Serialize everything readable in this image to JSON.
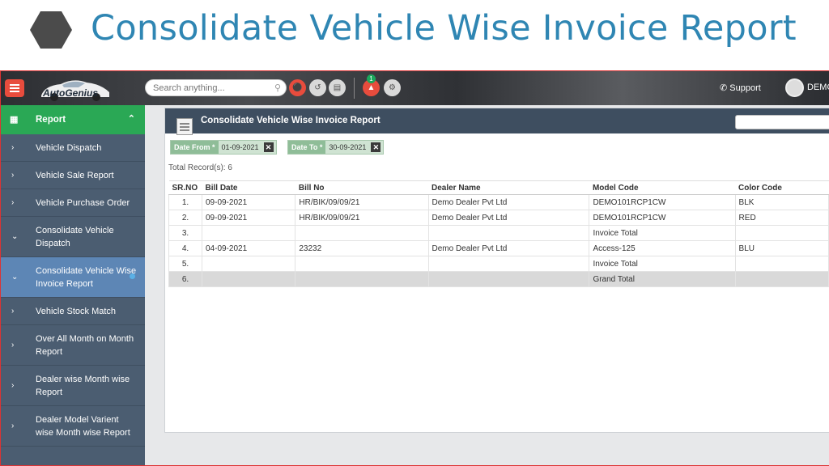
{
  "slide": {
    "title": "Consolidate Vehicle Wise Invoice Report"
  },
  "topbar": {
    "logo_text": "AutoGenius",
    "search_placeholder": "Search anything...",
    "notification_count": "1",
    "support_label": "Support",
    "user_name": "DEMO",
    "icon_colors": {
      "menu": "#e84c3d",
      "car": "#e84c3d",
      "share": "#d9d9d9",
      "chart": "#d9d9d9"
    }
  },
  "sidebar": {
    "header": {
      "label": "Report",
      "icon": "report-icon"
    },
    "items": [
      {
        "label": "Vehicle Dispatch",
        "arrow": "›"
      },
      {
        "label": "Vehicle Sale Report",
        "arrow": "›"
      },
      {
        "label": "Vehicle Purchase Order",
        "arrow": "›"
      },
      {
        "label": "Consolidate Vehicle Dispatch",
        "arrow": "⌄"
      },
      {
        "label": "Consolidate Vehicle Wise Invoice Report",
        "arrow": "⌄",
        "active": true
      },
      {
        "label": "Vehicle Stock Match",
        "arrow": "›"
      },
      {
        "label": "Over All Month on Month Report",
        "arrow": "›"
      },
      {
        "label": "Dealer wise Month wise Report",
        "arrow": "›"
      },
      {
        "label": "Dealer Model Varient wise Month wise Report",
        "arrow": "›"
      }
    ]
  },
  "panel": {
    "title": "Consolidate Vehicle Wise Invoice Report",
    "filters": [
      {
        "key": "Date From *",
        "value": "01-09-2021"
      },
      {
        "key": "Date To *",
        "value": "30-09-2021"
      }
    ],
    "total_records": "Total Record(s): 6"
  },
  "table": {
    "columns": [
      "SR.NO",
      "Bill Date",
      "Bill No",
      "Dealer Name",
      "Model Code",
      "Color Code"
    ],
    "rows": [
      [
        "1.",
        "09-09-2021",
        "HR/BIK/09/09/21",
        "Demo Dealer Pvt Ltd",
        "DEMO101RCP1CW",
        "BLK"
      ],
      [
        "2.",
        "09-09-2021",
        "HR/BIK/09/09/21",
        "Demo Dealer Pvt Ltd",
        "DEMO101RCP1CW",
        "RED"
      ],
      [
        "3.",
        "",
        "",
        "",
        "Invoice Total",
        ""
      ],
      [
        "4.",
        "04-09-2021",
        "23232",
        "Demo Dealer Pvt Ltd",
        "Access-125",
        "BLU"
      ],
      [
        "5.",
        "",
        "",
        "",
        "Invoice Total",
        ""
      ],
      [
        "6.",
        "",
        "",
        "",
        "Grand Total",
        ""
      ]
    ]
  }
}
